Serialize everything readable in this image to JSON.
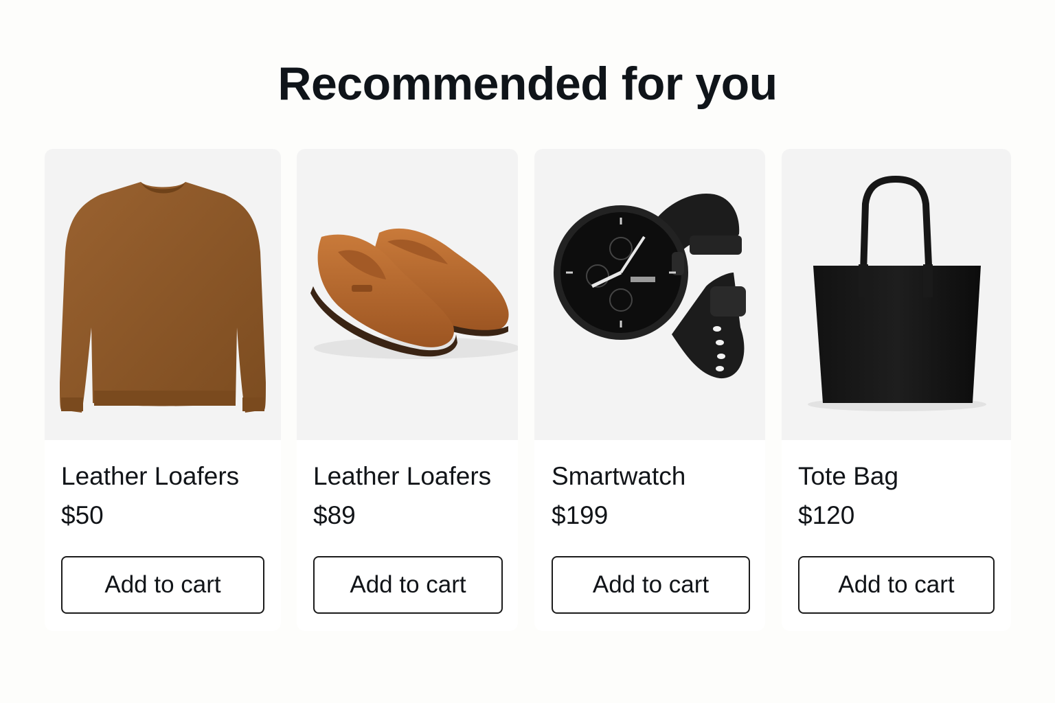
{
  "header": {
    "title": "Recommended for you"
  },
  "products": [
    {
      "image_icon": "sweater-image",
      "name": "Leather Loafers",
      "price": "$50",
      "button_label": "Add to cart",
      "color": "#8a5526"
    },
    {
      "image_icon": "loafers-image",
      "name": "Leather Loafers",
      "price": "$89",
      "button_label": "Add to cart",
      "color": "#b8692f"
    },
    {
      "image_icon": "smartwatch-image",
      "name": "Smartwatch",
      "price": "$199",
      "button_label": "Add to cart",
      "color": "#1a1a1a"
    },
    {
      "image_icon": "tote-bag-image",
      "name": "Tote Bag",
      "price": "$120",
      "button_label": "Add to cart",
      "color": "#151515"
    }
  ]
}
